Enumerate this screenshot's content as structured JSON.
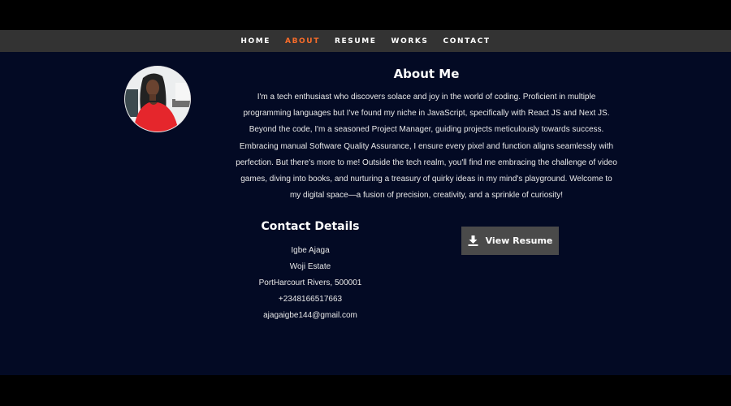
{
  "nav": {
    "items": [
      {
        "label": "HOME",
        "active": false
      },
      {
        "label": "ABOUT",
        "active": true
      },
      {
        "label": "RESUME",
        "active": false
      },
      {
        "label": "WORKS",
        "active": false
      },
      {
        "label": "CONTACT",
        "active": false
      }
    ]
  },
  "about": {
    "title": "About Me",
    "text": "I'm a tech enthusiast who discovers solace and joy in the world of coding. Proficient in multiple programming languages but I've found my niche in JavaScript, specifically with React JS and Next JS. Beyond the code, I'm a seasoned Project Manager, guiding projects meticulously towards success. Embracing manual Software Quality Assurance, I ensure every pixel and function aligns seamlessly with perfection. But there's more to me! Outside the tech realm, you'll find me embracing the challenge of video games, diving into books, and nurturing a treasury of quirky ideas in my mind's playground. Welcome to my digital space—a fusion of precision, creativity, and a sprinkle of curiosity!"
  },
  "contact": {
    "title": "Contact Details",
    "name": "Igbe Ajaga",
    "address1": "Woji Estate",
    "address2": "PortHarcourt Rivers, 500001",
    "phone": "+2348166517663",
    "email": "ajagaigbe144@gmail.com"
  },
  "resume_button": {
    "label": "View Resume",
    "icon": "download-icon"
  },
  "colors": {
    "nav_bg": "#333333",
    "accent": "#f86c2a",
    "section_bg": "#030a24",
    "button_bg": "#4a4a4a"
  }
}
